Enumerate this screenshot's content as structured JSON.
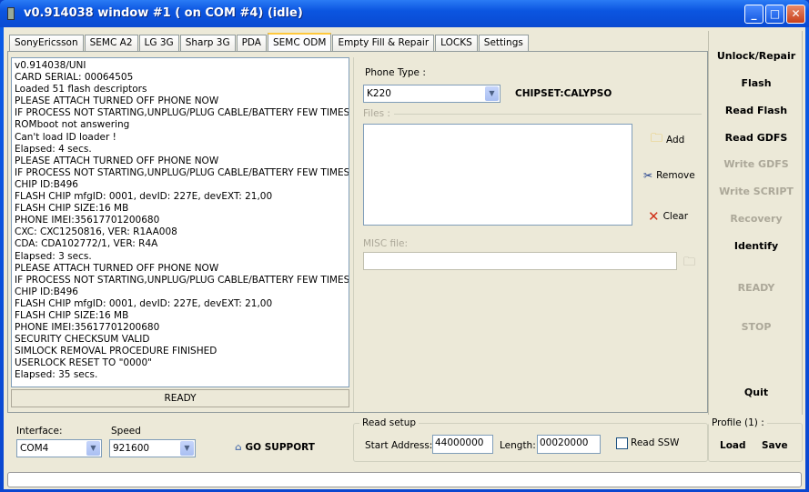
{
  "window": {
    "title": "v0.914038 window #1 ( on COM #4) (idle)",
    "controls": {
      "minimize": "_",
      "maximize": "□",
      "close": "✕"
    }
  },
  "tabs": [
    {
      "label": "SonyEricsson"
    },
    {
      "label": "SEMC A2"
    },
    {
      "label": "LG 3G"
    },
    {
      "label": "Sharp 3G"
    },
    {
      "label": "PDA"
    },
    {
      "label": "SEMC ODM",
      "active": true
    },
    {
      "label": "Empty Fill & Repair"
    },
    {
      "label": "LOCKS"
    },
    {
      "label": "Settings"
    }
  ],
  "log": [
    "v0.914038/UNI",
    "CARD SERIAL: 00064505",
    "Loaded 51 flash descriptors",
    "PLEASE ATTACH TURNED OFF PHONE NOW",
    "IF PROCESS NOT STARTING,UNPLUG/PLUG CABLE/BATTERY FEW TIMES...",
    "ROMboot not answering",
    "Can't load ID loader !",
    "Elapsed: 4 secs.",
    "PLEASE ATTACH TURNED OFF PHONE NOW",
    "IF PROCESS NOT STARTING,UNPLUG/PLUG CABLE/BATTERY FEW TIMES...",
    "CHIP ID:B496",
    "FLASH CHIP mfgID: 0001, devID: 227E, devEXT: 21,00",
    "FLASH CHIP SIZE:16 MB",
    "PHONE IMEI:35617701200680",
    "CXC: CXC1250816, VER: R1AA008",
    "CDA: CDA102772/1, VER: R4A",
    "Elapsed: 3 secs.",
    "PLEASE ATTACH TURNED OFF PHONE NOW",
    "IF PROCESS NOT STARTING,UNPLUG/PLUG CABLE/BATTERY FEW TIMES...",
    "CHIP ID:B496",
    "FLASH CHIP mfgID: 0001, devID: 227E, devEXT: 21,00",
    "FLASH CHIP SIZE:16 MB",
    "PHONE IMEI:35617701200680",
    "SECURITY CHECKSUM VALID",
    "SIMLOCK REMOVAL PROCEDURE FINISHED",
    "USERLOCK RESET TO \"0000\"",
    "Elapsed: 35 secs."
  ],
  "ready_bar": "READY",
  "mid": {
    "phone_type_label": "Phone Type :",
    "phone_type_value": "K220",
    "chipset": "CHIPSET:CALYPSO",
    "files_label": "Files :",
    "add": "Add",
    "remove": "Remove",
    "clear": "Clear",
    "misc_label": "MISC file:",
    "misc_value": ""
  },
  "actions": [
    {
      "label": "Unlock/Repair",
      "enabled": true
    },
    {
      "label": "Flash",
      "enabled": true
    },
    {
      "label": "Read Flash",
      "enabled": true
    },
    {
      "label": "Read GDFS",
      "enabled": true
    },
    {
      "label": "Write GDFS",
      "enabled": false
    },
    {
      "label": "Write SCRIPT",
      "enabled": false
    },
    {
      "label": "Recovery",
      "enabled": false
    },
    {
      "label": "Identify",
      "enabled": true
    },
    {
      "label": "READY",
      "enabled": false
    },
    {
      "label": "STOP",
      "enabled": false
    },
    {
      "label": "Quit",
      "enabled": true
    }
  ],
  "bottom": {
    "interface_label": "Interface:",
    "interface_value": "COM4",
    "speed_label": "Speed",
    "speed_value": "921600",
    "support": "GO SUPPORT",
    "read_setup": "Read setup",
    "start_label": "Start Address:",
    "start_value": "44000000",
    "length_label": "Length:",
    "length_value": "00020000",
    "read_ssw": "Read SSW",
    "read_ssw_checked": false,
    "profile_label": "Profile (1) :",
    "load": "Load",
    "save": "Save"
  },
  "colors": {
    "titlebar": "#0a55e0",
    "face": "#ece9d8",
    "disabled": "#aca899"
  }
}
